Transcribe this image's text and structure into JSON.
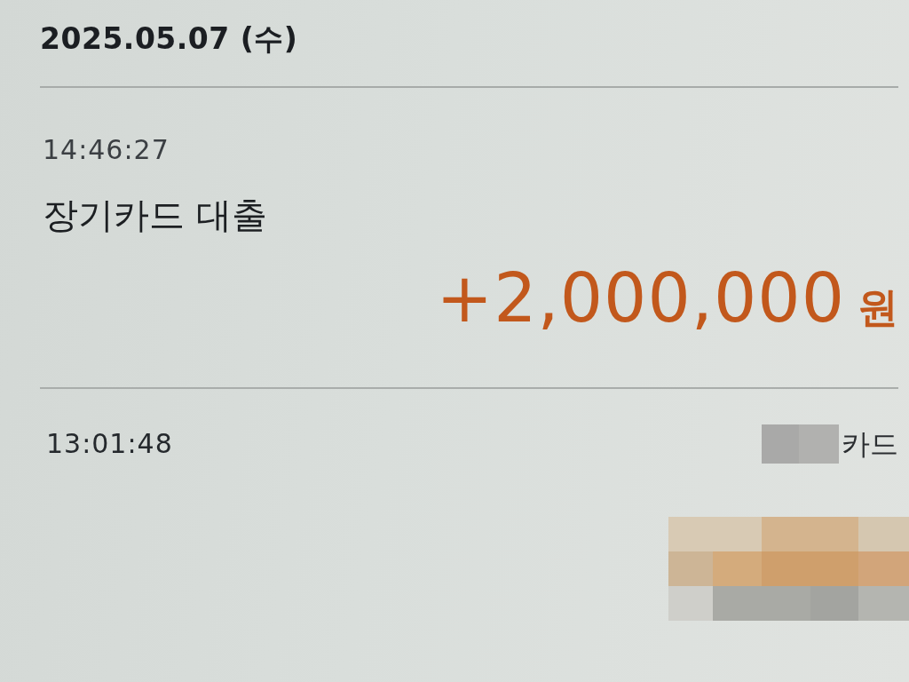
{
  "date_header": "2025.05.07 (수)",
  "transactions": [
    {
      "kind": "deposit",
      "time": "14:46:27",
      "title": "장기카드 대출",
      "amount": "+2,000,000",
      "currency": "원"
    },
    {
      "kind": "card_payment",
      "time": "13:01:48",
      "merchant": "카드"
    }
  ]
}
